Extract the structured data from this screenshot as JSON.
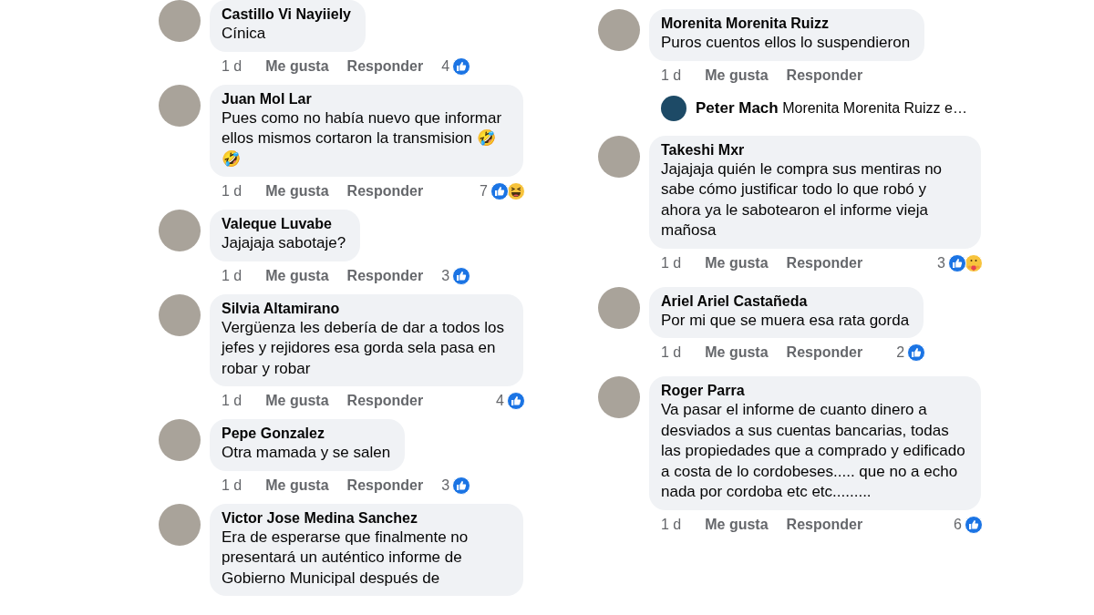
{
  "columns": [
    {
      "comments": [
        {
          "author": "Castillo Vi Nayiiely",
          "text": "Cínica",
          "time": "1 d",
          "like": "Me gusta",
          "reply": "Responder",
          "count": "4",
          "reactions": [
            {
              "kind": "like"
            }
          ]
        },
        {
          "author": "Juan Mol Lar",
          "text": "Pues como no había nuevo que informar ellos mismos  cortaron la transmision 🤣🤣",
          "time": "1 d",
          "like": "Me gusta",
          "reply": "Responder",
          "count": "7",
          "reactions": [
            {
              "kind": "like"
            },
            {
              "kind": "haha"
            }
          ]
        },
        {
          "author": "Valeque Luvabe",
          "text": "Jajajaja sabotaje?",
          "time": "1 d",
          "like": "Me gusta",
          "reply": "Responder",
          "count": "3",
          "reactions": [
            {
              "kind": "like"
            }
          ]
        },
        {
          "author": "Silvia Altamirano",
          "text": "Vergüenza les debería de dar a todos los jefes y rejidores esa gorda sela pasa en robar y robar",
          "time": "1 d",
          "like": "Me gusta",
          "reply": "Responder",
          "count": "4",
          "reactions": [
            {
              "kind": "like"
            }
          ]
        },
        {
          "author": "Pepe Gonzalez",
          "text": "Otra mamada y se salen",
          "time": "1 d",
          "like": "Me gusta",
          "reply": "Responder",
          "count": "3",
          "reactions": [
            {
              "kind": "like"
            }
          ]
        },
        {
          "author": "Victor Jose Medina Sanchez",
          "text": "Era de esperarse que finalmente no presentará un auténtico informe de Gobierno Municipal después de"
        }
      ]
    },
    {
      "comments": [
        {
          "author": "Morenita Morenita Ruizz",
          "text": "Puros cuentos ellos lo suspendieron",
          "time": "1 d",
          "like": "Me gusta",
          "reply": "Responder",
          "replies": [
            {
              "author": "Peter Mach",
              "text": "Morenita Morenita Ruizz e…"
            }
          ]
        },
        {
          "author": "Takeshi Mxr",
          "text": "Jajajaja quién le compra sus mentiras no sabe cómo justificar todo lo que robó y ahora ya le sabotearon el informe vieja mañosa",
          "time": "1 d",
          "like": "Me gusta",
          "reply": "Responder",
          "count": "3",
          "reactions": [
            {
              "kind": "like"
            },
            {
              "kind": "care"
            }
          ]
        },
        {
          "author": "Ariel Ariel Castañeda",
          "text": "Por mi que se muera esa rata gorda",
          "time": "1 d",
          "like": "Me gusta",
          "reply": "Responder",
          "count": "2",
          "reactions": [
            {
              "kind": "like"
            }
          ]
        },
        {
          "author": "Roger Parra",
          "text": "Va pasar el informe de cuanto dinero a desviados a sus cuentas bancarias, todas las propiedades que a comprado y edificado a costa de lo cordobeses..... que no a echo nada por cordoba etc etc.........",
          "time": "1 d",
          "like": "Me gusta",
          "reply": "Responder",
          "count": "6",
          "reactions": [
            {
              "kind": "like"
            }
          ]
        }
      ]
    }
  ]
}
